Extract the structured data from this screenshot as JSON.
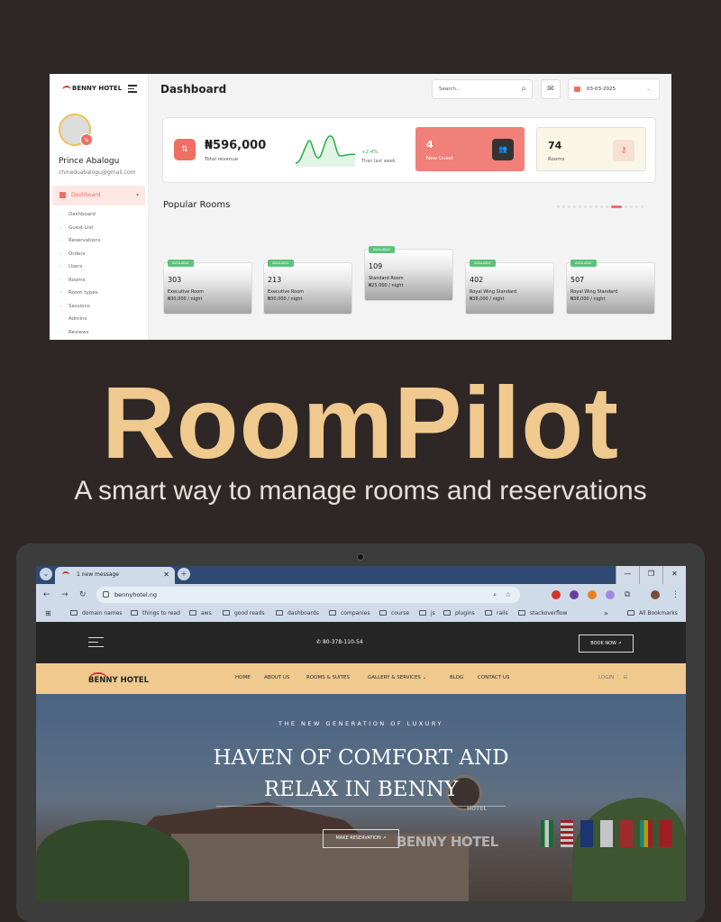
{
  "dashboard": {
    "logo": "BENNY HOTEL",
    "title": "Dashboard",
    "search_placeholder": "Search...",
    "date": "03-03-2025",
    "user": {
      "name": "Prince Abalogu",
      "email": "chineduabalogu@gmail.com"
    },
    "menu": {
      "active": "Dashboard",
      "items": [
        "Dashboard",
        "Guest List",
        "Reservations",
        "Orders",
        "Users",
        "Rooms",
        "Room types",
        "Sessions",
        "Admins",
        "Reviews"
      ]
    },
    "revenue": {
      "value": "₦596,000",
      "label": "Total revenue",
      "change": "+2.4%",
      "change_label": "Than last week"
    },
    "new_guest": {
      "value": "4",
      "label": "New Guest"
    },
    "rooms_stat": {
      "value": "74",
      "label": "Rooms"
    },
    "popular_title": "Popular Rooms",
    "rooms": [
      {
        "badge": "AVAILABLE",
        "number": "303",
        "type": "Executive Room",
        "price": "₦30,000 / night"
      },
      {
        "badge": "AVAILABLE",
        "number": "213",
        "type": "Executive Room",
        "price": "₦30,000 / night"
      },
      {
        "badge": "AVAILABLE",
        "number": "109",
        "type": "Standard Room",
        "price": "₦25,000 / night"
      },
      {
        "badge": "AVAILABLE",
        "number": "402",
        "type": "Royal Wing Standard",
        "price": "₦38,000 / night"
      },
      {
        "badge": "AVAILABLE",
        "number": "507",
        "type": "Royal Wing Standard",
        "price": "₦38,000 / night"
      }
    ],
    "colors": {
      "accent": "#ef6f64",
      "badge": "#5bc27a",
      "success": "#2db34a"
    }
  },
  "brand": {
    "name": "RoomPilot",
    "tagline": "A smart way to manage rooms and reservations",
    "color": "#efc98e",
    "background": "#2e2725"
  },
  "browser": {
    "tab_title": "1 new message",
    "url": "bennyhotel.ng",
    "bookmarks": [
      "domain names",
      "things to read",
      "aws",
      "good reads",
      "dashboards",
      "companies",
      "course",
      "js",
      "plugins",
      "rails",
      "stackoverflow"
    ],
    "all_bookmarks": "All Bookmarks",
    "overflow": "»"
  },
  "site": {
    "phone": "80-378-110-54",
    "book_now": "BOOK NOW",
    "logo": "BENNY HOTEL",
    "nav": [
      "HOME",
      "ABOUT US",
      "ROOMS & SUITES",
      "GALLERY & SERVICES",
      "BLOG",
      "CONTACT US"
    ],
    "login": "LOGIN",
    "hero": {
      "kicker": "THE NEW GENERATION OF LUXURY",
      "title_line1": "HAVEN OF COMFORT AND",
      "title_line2": "RELAX IN BENNY",
      "cta": "MAKE RESERVATION",
      "sign": "BENNY HOTEL",
      "sign_small": "HOTEL"
    }
  }
}
